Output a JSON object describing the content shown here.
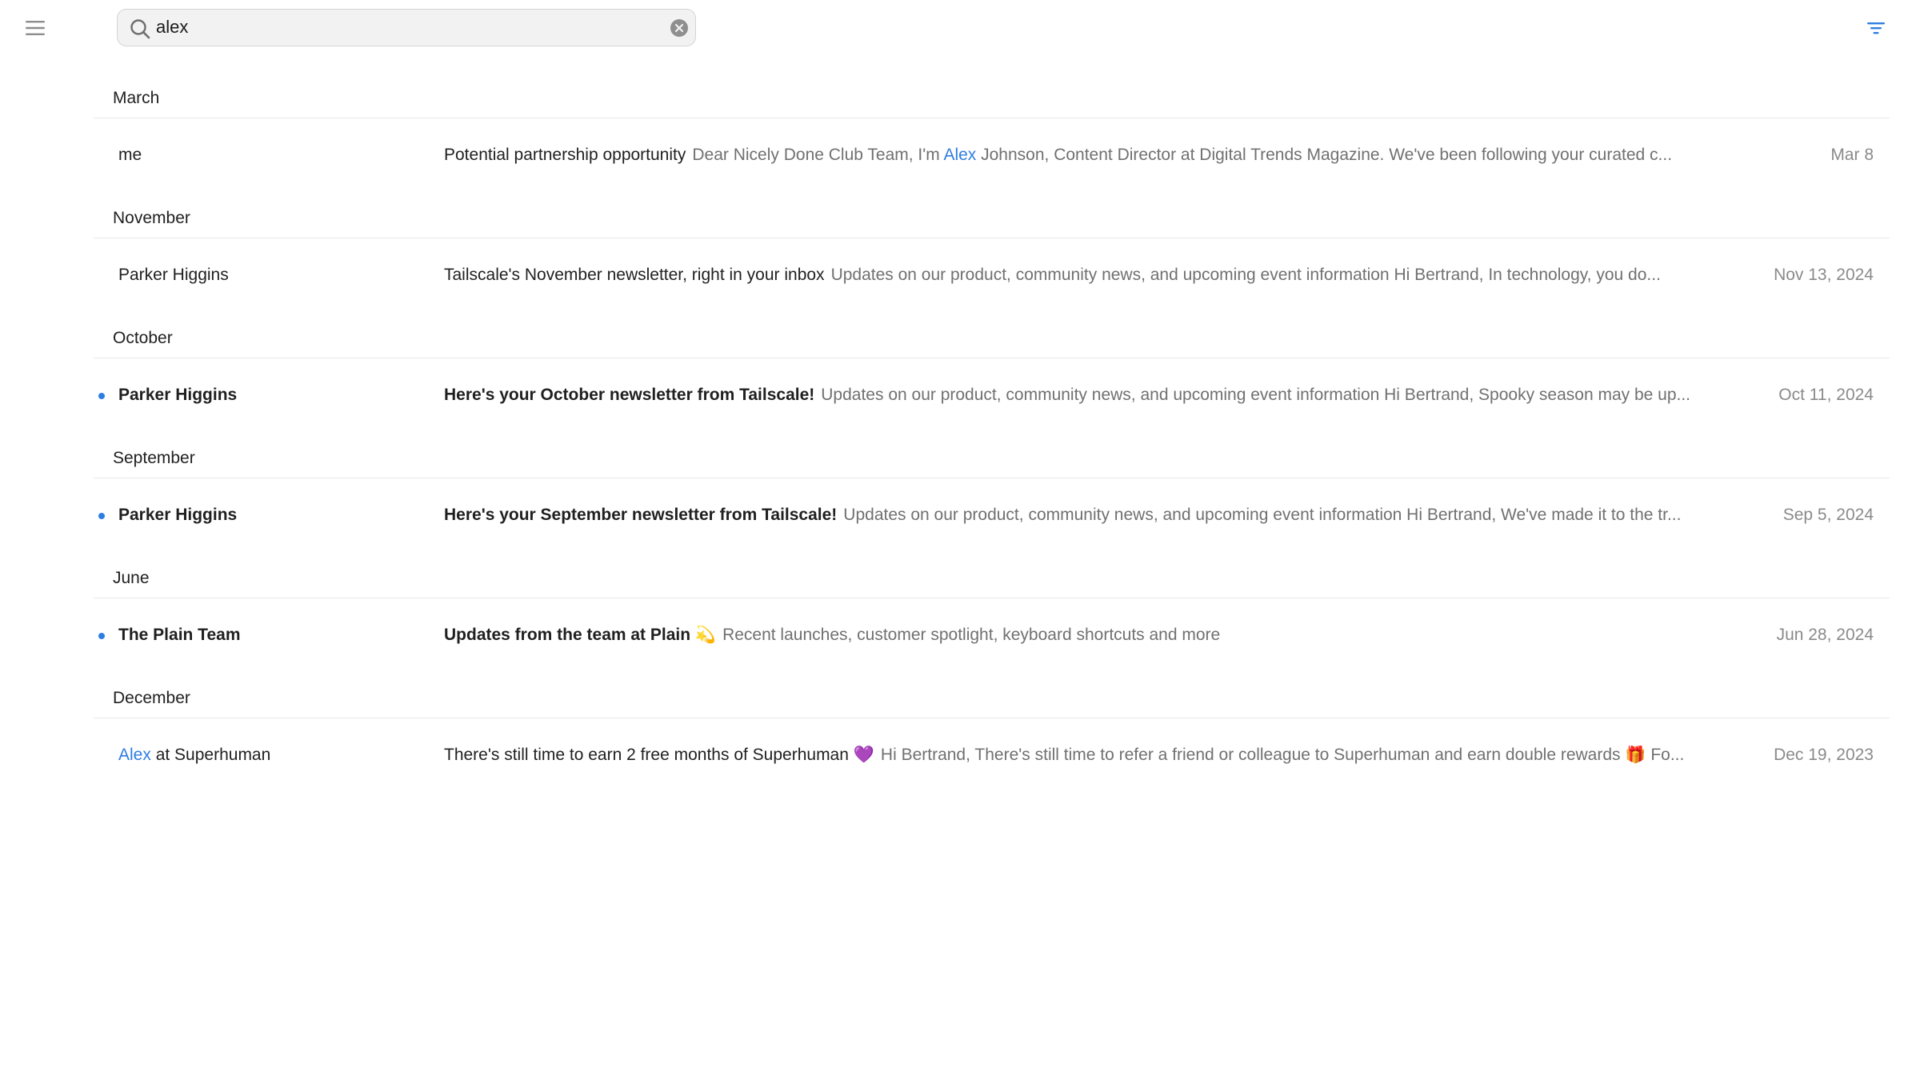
{
  "search": {
    "value": "alex"
  },
  "sections": [
    {
      "label": "March",
      "rows": [
        {
          "unread": false,
          "sender_pre": "",
          "sender_hl": "",
          "sender_post": "me",
          "subject": "Potential partnership opportunity",
          "snippet_pre": "Dear Nicely Done Club Team, I'm ",
          "snippet_hl": "Alex",
          "snippet_post": " Johnson, Content Director at Digital Trends Magazine. We've been following your curated c...",
          "date": "Mar 8"
        }
      ]
    },
    {
      "label": "November",
      "rows": [
        {
          "unread": false,
          "sender_pre": "",
          "sender_hl": "",
          "sender_post": "Parker Higgins",
          "subject": "Tailscale's November newsletter, right in your inbox",
          "snippet_pre": "Updates on our product, community news, and upcoming event information Hi Bertrand, In technology, you do...",
          "snippet_hl": "",
          "snippet_post": "",
          "date": "Nov 13, 2024"
        }
      ]
    },
    {
      "label": "October",
      "rows": [
        {
          "unread": true,
          "sender_pre": "",
          "sender_hl": "",
          "sender_post": "Parker Higgins",
          "subject": "Here's your October newsletter from Tailscale!",
          "snippet_pre": "Updates on our product, community news, and upcoming event information Hi Bertrand, Spooky season may be up...",
          "snippet_hl": "",
          "snippet_post": "",
          "date": "Oct 11, 2024"
        }
      ]
    },
    {
      "label": "September",
      "rows": [
        {
          "unread": true,
          "sender_pre": "",
          "sender_hl": "",
          "sender_post": "Parker Higgins",
          "subject": "Here's your September newsletter from Tailscale!",
          "snippet_pre": "Updates on our product, community news, and upcoming event information Hi Bertrand, We've made it to the tr...",
          "snippet_hl": "",
          "snippet_post": "",
          "date": "Sep 5, 2024"
        }
      ]
    },
    {
      "label": "June",
      "rows": [
        {
          "unread": true,
          "sender_pre": "",
          "sender_hl": "",
          "sender_post": "The Plain Team",
          "subject": "Updates from the team at Plain 💫",
          "snippet_pre": "Recent launches, customer spotlight, keyboard shortcuts and more",
          "snippet_hl": "",
          "snippet_post": "",
          "date": "Jun 28, 2024"
        }
      ]
    },
    {
      "label": "December",
      "rows": [
        {
          "unread": false,
          "sender_pre": "",
          "sender_hl": "Alex",
          "sender_post": " at Superhuman",
          "subject": "There's still time to earn 2 free months of Superhuman 💜",
          "snippet_pre": "Hi Bertrand, There's still time to refer a friend or colleague to Superhuman and earn double rewards 🎁 Fo...",
          "snippet_hl": "",
          "snippet_post": "",
          "date": "Dec 19, 2023"
        }
      ]
    }
  ],
  "icons": {
    "menu": "hamburger-menu-icon",
    "search": "search-icon",
    "clear": "clear-search-icon",
    "filter": "filter-icon"
  },
  "colors": {
    "accent": "#2f7de1",
    "snippet": "#707070",
    "date": "#8a8a8a"
  }
}
